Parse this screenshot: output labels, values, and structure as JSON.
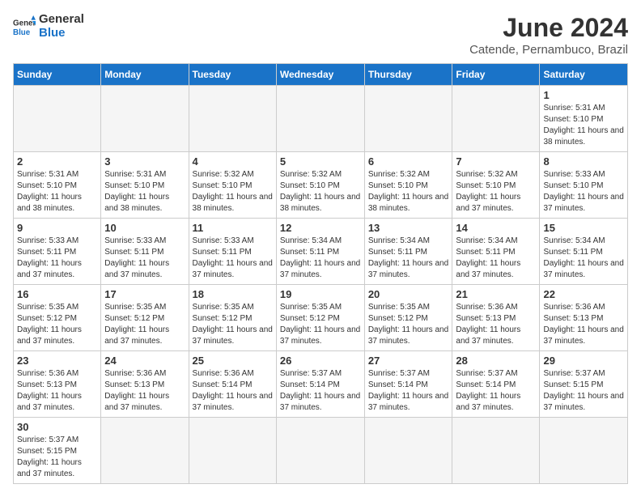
{
  "logo": {
    "text_general": "General",
    "text_blue": "Blue"
  },
  "header": {
    "month_title": "June 2024",
    "subtitle": "Catende, Pernambuco, Brazil"
  },
  "days_of_week": [
    "Sunday",
    "Monday",
    "Tuesday",
    "Wednesday",
    "Thursday",
    "Friday",
    "Saturday"
  ],
  "weeks": [
    [
      {
        "day": "",
        "empty": true
      },
      {
        "day": "",
        "empty": true
      },
      {
        "day": "",
        "empty": true
      },
      {
        "day": "",
        "empty": true
      },
      {
        "day": "",
        "empty": true
      },
      {
        "day": "",
        "empty": true
      },
      {
        "day": "1",
        "sunrise": "5:31 AM",
        "sunset": "5:10 PM",
        "daylight": "11 hours and 38 minutes."
      }
    ],
    [
      {
        "day": "2",
        "sunrise": "5:31 AM",
        "sunset": "5:10 PM",
        "daylight": "11 hours and 38 minutes."
      },
      {
        "day": "3",
        "sunrise": "5:31 AM",
        "sunset": "5:10 PM",
        "daylight": "11 hours and 38 minutes."
      },
      {
        "day": "4",
        "sunrise": "5:32 AM",
        "sunset": "5:10 PM",
        "daylight": "11 hours and 38 minutes."
      },
      {
        "day": "5",
        "sunrise": "5:32 AM",
        "sunset": "5:10 PM",
        "daylight": "11 hours and 38 minutes."
      },
      {
        "day": "6",
        "sunrise": "5:32 AM",
        "sunset": "5:10 PM",
        "daylight": "11 hours and 38 minutes."
      },
      {
        "day": "7",
        "sunrise": "5:32 AM",
        "sunset": "5:10 PM",
        "daylight": "11 hours and 37 minutes."
      },
      {
        "day": "8",
        "sunrise": "5:33 AM",
        "sunset": "5:10 PM",
        "daylight": "11 hours and 37 minutes."
      }
    ],
    [
      {
        "day": "9",
        "sunrise": "5:33 AM",
        "sunset": "5:11 PM",
        "daylight": "11 hours and 37 minutes."
      },
      {
        "day": "10",
        "sunrise": "5:33 AM",
        "sunset": "5:11 PM",
        "daylight": "11 hours and 37 minutes."
      },
      {
        "day": "11",
        "sunrise": "5:33 AM",
        "sunset": "5:11 PM",
        "daylight": "11 hours and 37 minutes."
      },
      {
        "day": "12",
        "sunrise": "5:34 AM",
        "sunset": "5:11 PM",
        "daylight": "11 hours and 37 minutes."
      },
      {
        "day": "13",
        "sunrise": "5:34 AM",
        "sunset": "5:11 PM",
        "daylight": "11 hours and 37 minutes."
      },
      {
        "day": "14",
        "sunrise": "5:34 AM",
        "sunset": "5:11 PM",
        "daylight": "11 hours and 37 minutes."
      },
      {
        "day": "15",
        "sunrise": "5:34 AM",
        "sunset": "5:11 PM",
        "daylight": "11 hours and 37 minutes."
      }
    ],
    [
      {
        "day": "16",
        "sunrise": "5:35 AM",
        "sunset": "5:12 PM",
        "daylight": "11 hours and 37 minutes."
      },
      {
        "day": "17",
        "sunrise": "5:35 AM",
        "sunset": "5:12 PM",
        "daylight": "11 hours and 37 minutes."
      },
      {
        "day": "18",
        "sunrise": "5:35 AM",
        "sunset": "5:12 PM",
        "daylight": "11 hours and 37 minutes."
      },
      {
        "day": "19",
        "sunrise": "5:35 AM",
        "sunset": "5:12 PM",
        "daylight": "11 hours and 37 minutes."
      },
      {
        "day": "20",
        "sunrise": "5:35 AM",
        "sunset": "5:12 PM",
        "daylight": "11 hours and 37 minutes."
      },
      {
        "day": "21",
        "sunrise": "5:36 AM",
        "sunset": "5:13 PM",
        "daylight": "11 hours and 37 minutes."
      },
      {
        "day": "22",
        "sunrise": "5:36 AM",
        "sunset": "5:13 PM",
        "daylight": "11 hours and 37 minutes."
      }
    ],
    [
      {
        "day": "23",
        "sunrise": "5:36 AM",
        "sunset": "5:13 PM",
        "daylight": "11 hours and 37 minutes."
      },
      {
        "day": "24",
        "sunrise": "5:36 AM",
        "sunset": "5:13 PM",
        "daylight": "11 hours and 37 minutes."
      },
      {
        "day": "25",
        "sunrise": "5:36 AM",
        "sunset": "5:14 PM",
        "daylight": "11 hours and 37 minutes."
      },
      {
        "day": "26",
        "sunrise": "5:37 AM",
        "sunset": "5:14 PM",
        "daylight": "11 hours and 37 minutes."
      },
      {
        "day": "27",
        "sunrise": "5:37 AM",
        "sunset": "5:14 PM",
        "daylight": "11 hours and 37 minutes."
      },
      {
        "day": "28",
        "sunrise": "5:37 AM",
        "sunset": "5:14 PM",
        "daylight": "11 hours and 37 minutes."
      },
      {
        "day": "29",
        "sunrise": "5:37 AM",
        "sunset": "5:15 PM",
        "daylight": "11 hours and 37 minutes."
      }
    ],
    [
      {
        "day": "30",
        "sunrise": "5:37 AM",
        "sunset": "5:15 PM",
        "daylight": "11 hours and 37 minutes."
      },
      {
        "day": "",
        "empty": true
      },
      {
        "day": "",
        "empty": true
      },
      {
        "day": "",
        "empty": true
      },
      {
        "day": "",
        "empty": true
      },
      {
        "day": "",
        "empty": true
      },
      {
        "day": "",
        "empty": true
      }
    ]
  ]
}
